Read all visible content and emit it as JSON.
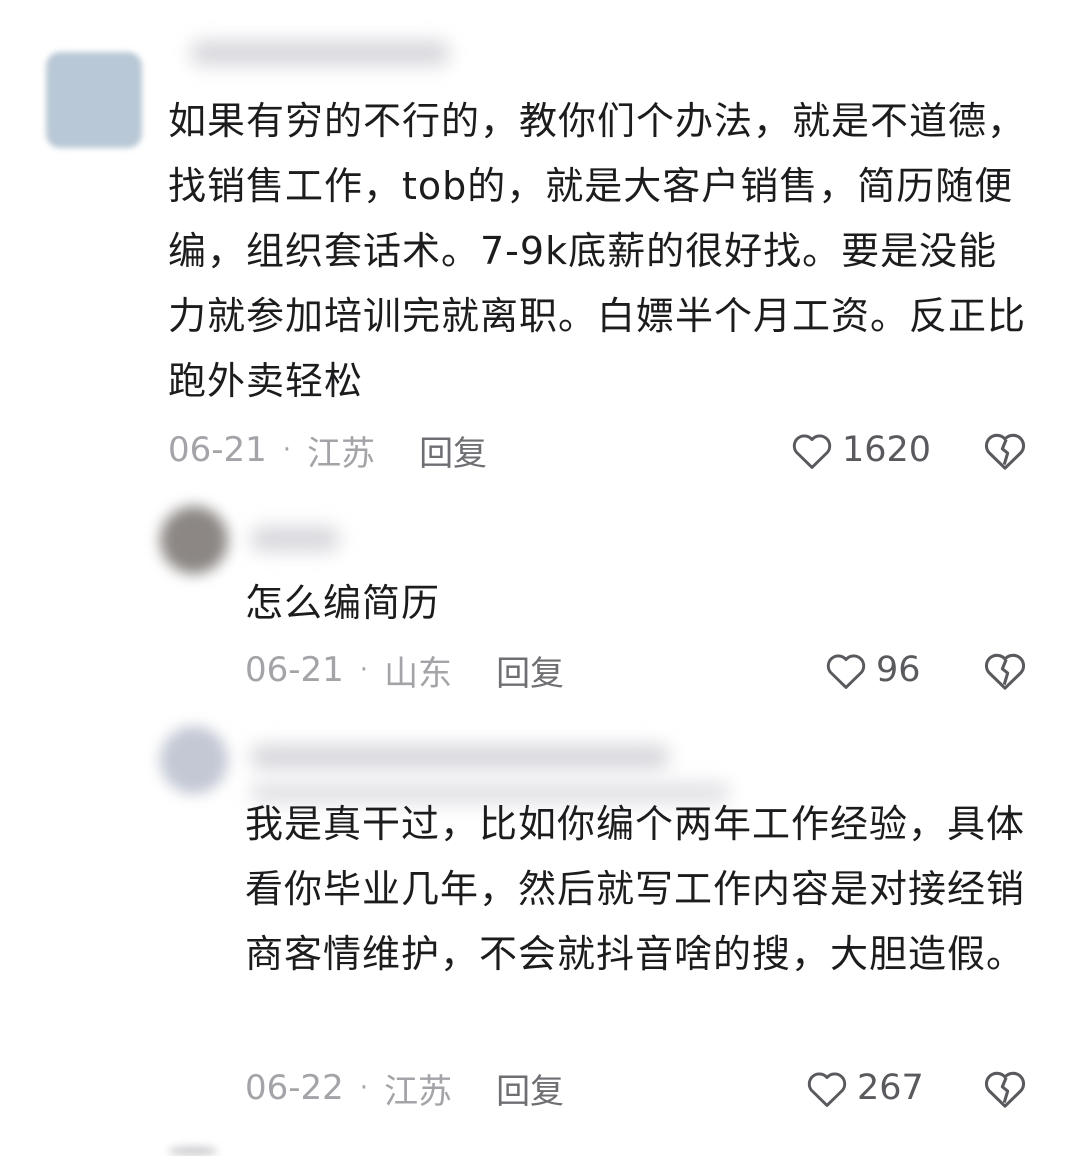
{
  "comments": [
    {
      "text": "如果有穷的不行的，教你们个办法，就是不道德，找销售工作，tob的，就是大客户销售，简历随便编，组织套话术。7-9k底薪的很好找。要是没能力就参加培训完就离职。白嫖半个月工资。反正比跑外卖轻松",
      "date": "06-21",
      "separator": "·",
      "location": "江苏",
      "reply_label": "回复",
      "likes": "1620",
      "avatar_color": "#b9c8d6"
    },
    {
      "text": "怎么编简历",
      "date": "06-21",
      "separator": "·",
      "location": "山东",
      "reply_label": "回复",
      "likes": "96",
      "avatar_color": "#8c8784"
    },
    {
      "text": "我是真干过，比如你编个两年工作经验，具体看你毕业几年，然后就写工作内容是对接经销商客情维护，不会就抖音啥的搜，大胆造假。",
      "date": "06-22",
      "separator": "·",
      "location": "江苏",
      "reply_label": "回复",
      "likes": "267",
      "avatar_color": "#c3c8d4"
    }
  ],
  "icons": {
    "like": "heart-outline-icon",
    "dislike": "broken-heart-icon"
  },
  "colors": {
    "text": "#1c1c1e",
    "meta": "#a3a3a8",
    "icon": "#5a5a5e"
  }
}
